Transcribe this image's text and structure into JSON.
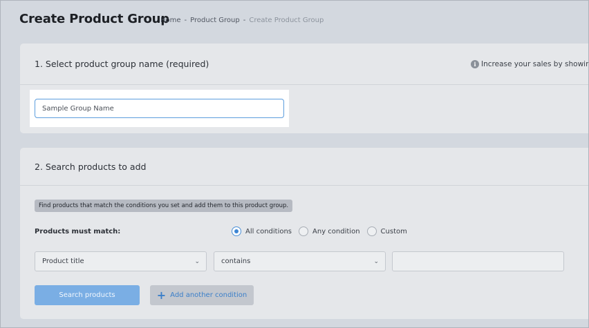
{
  "header": {
    "title": "Create Product Group",
    "breadcrumb": [
      "Home",
      "-",
      "Product Group",
      "-",
      "Create Product Group"
    ]
  },
  "section1": {
    "title": "1. Select product group name (required)",
    "hint": "Increase your sales by showing",
    "info_icon": "i",
    "name_input_value": "Sample Group Name"
  },
  "section2": {
    "title": "2. Search products to add",
    "notice": "Find products that match the conditions you set and add them to this product group.",
    "match_label": "Products must match:",
    "match_options": [
      {
        "label": "All conditions",
        "selected": true
      },
      {
        "label": "Any condition",
        "selected": false
      },
      {
        "label": "Custom",
        "selected": false
      }
    ],
    "condition_field": "Product title",
    "condition_operator": "contains",
    "condition_value": "",
    "search_button": "Search products",
    "add_condition_button": "Add another condition"
  },
  "colors": {
    "accent": "#3d86d4",
    "background": "#d3d8df",
    "card": "#e5e7ea"
  }
}
